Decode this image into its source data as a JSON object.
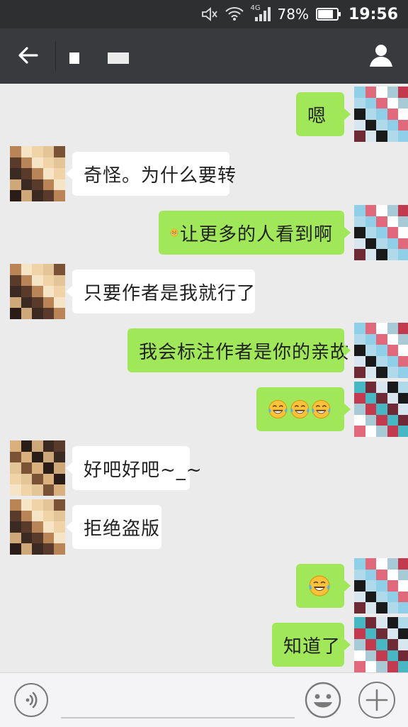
{
  "status_bar": {
    "network": "4G",
    "battery": "78%",
    "time": "19:56"
  },
  "header": {
    "back_icon": "arrow-left-icon",
    "profile_icon": "person-icon"
  },
  "messages": [
    {
      "side": "right",
      "text": "嗯",
      "emoji_count": 0
    },
    {
      "side": "left",
      "text": "奇怪。为什么要转",
      "emoji_count": 0
    },
    {
      "side": "right",
      "text": "让更多的人看到啊",
      "emoji_count": 1
    },
    {
      "side": "left",
      "text": "只要作者是我就行了",
      "emoji_count": 0
    },
    {
      "side": "right",
      "text": "我会标注作者是你的亲故",
      "emoji_count": 0
    },
    {
      "side": "right",
      "text": "",
      "emoji_count": 3
    },
    {
      "side": "left",
      "text": "好吧好吧~_~",
      "emoji_count": 0
    },
    {
      "side": "left",
      "text": "拒绝盗版",
      "emoji_count": 0
    },
    {
      "side": "right",
      "text": "",
      "emoji_count": 1
    },
    {
      "side": "right",
      "text": "知道了",
      "emoji_count": 0
    }
  ],
  "input_bar": {
    "voice_icon": "voice-icon",
    "emoji_icon": "smiley-icon",
    "more_icon": "plus-icon"
  },
  "colors": {
    "status_bg": "#2e2f31",
    "header_bg": "#393a3e",
    "chat_bg": "#ebebeb",
    "bubble_self": "#a0e75a",
    "bubble_other": "#ffffff"
  }
}
